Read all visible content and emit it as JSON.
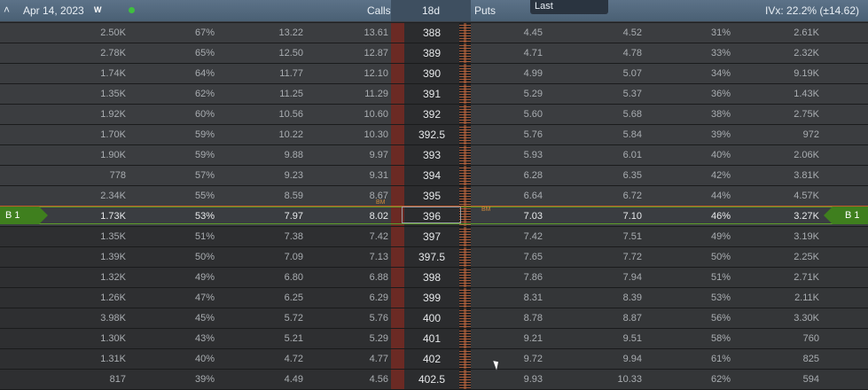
{
  "header": {
    "collapse_icon": "chevron-up-icon",
    "expiration": "Apr 14, 2023",
    "weekly_flag": "W",
    "status_dot_color": "#3fbf3f",
    "calls_label": "Calls",
    "dte_label": "18d",
    "puts_label": "Puts",
    "last_label": "Last",
    "ivx": "IVx: 22.2% (±14.62)"
  },
  "atm": {
    "left_tag": "B 1",
    "right_tag": "B 1",
    "left_marker": "BM",
    "right_marker": "BM"
  },
  "rows": [
    {
      "cvol": "2.50K",
      "cprob": "67%",
      "cbid": "13.22",
      "cask": "13.61",
      "strike": "388",
      "pbid": "4.45",
      "pask": "4.52",
      "pprob": "31%",
      "pvol": "2.61K"
    },
    {
      "cvol": "2.78K",
      "cprob": "65%",
      "cbid": "12.50",
      "cask": "12.87",
      "strike": "389",
      "pbid": "4.71",
      "pask": "4.78",
      "pprob": "33%",
      "pvol": "2.32K"
    },
    {
      "cvol": "1.74K",
      "cprob": "64%",
      "cbid": "11.77",
      "cask": "12.10",
      "strike": "390",
      "pbid": "4.99",
      "pask": "5.07",
      "pprob": "34%",
      "pvol": "9.19K"
    },
    {
      "cvol": "1.35K",
      "cprob": "62%",
      "cbid": "11.25",
      "cask": "11.29",
      "strike": "391",
      "pbid": "5.29",
      "pask": "5.37",
      "pprob": "36%",
      "pvol": "1.43K"
    },
    {
      "cvol": "1.92K",
      "cprob": "60%",
      "cbid": "10.56",
      "cask": "10.60",
      "strike": "392",
      "pbid": "5.60",
      "pask": "5.68",
      "pprob": "38%",
      "pvol": "2.75K"
    },
    {
      "cvol": "1.70K",
      "cprob": "59%",
      "cbid": "10.22",
      "cask": "10.30",
      "strike": "392.5",
      "pbid": "5.76",
      "pask": "5.84",
      "pprob": "39%",
      "pvol": "972"
    },
    {
      "cvol": "1.90K",
      "cprob": "59%",
      "cbid": "9.88",
      "cask": "9.97",
      "strike": "393",
      "pbid": "5.93",
      "pask": "6.01",
      "pprob": "40%",
      "pvol": "2.06K"
    },
    {
      "cvol": "778",
      "cprob": "57%",
      "cbid": "9.23",
      "cask": "9.31",
      "strike": "394",
      "pbid": "6.28",
      "pask": "6.35",
      "pprob": "42%",
      "pvol": "3.81K"
    },
    {
      "cvol": "2.34K",
      "cprob": "55%",
      "cbid": "8.59",
      "cask": "8.67",
      "strike": "395",
      "pbid": "6.64",
      "pask": "6.72",
      "pprob": "44%",
      "pvol": "4.57K"
    },
    {
      "cvol": "1.73K",
      "cprob": "53%",
      "cbid": "7.97",
      "cask": "8.02",
      "strike": "396",
      "pbid": "7.03",
      "pask": "7.10",
      "pprob": "46%",
      "pvol": "3.27K"
    },
    {
      "cvol": "1.35K",
      "cprob": "51%",
      "cbid": "7.38",
      "cask": "7.42",
      "strike": "397",
      "pbid": "7.42",
      "pask": "7.51",
      "pprob": "49%",
      "pvol": "3.19K"
    },
    {
      "cvol": "1.39K",
      "cprob": "50%",
      "cbid": "7.09",
      "cask": "7.13",
      "strike": "397.5",
      "pbid": "7.65",
      "pask": "7.72",
      "pprob": "50%",
      "pvol": "2.25K"
    },
    {
      "cvol": "1.32K",
      "cprob": "49%",
      "cbid": "6.80",
      "cask": "6.88",
      "strike": "398",
      "pbid": "7.86",
      "pask": "7.94",
      "pprob": "51%",
      "pvol": "2.71K"
    },
    {
      "cvol": "1.26K",
      "cprob": "47%",
      "cbid": "6.25",
      "cask": "6.29",
      "strike": "399",
      "pbid": "8.31",
      "pask": "8.39",
      "pprob": "53%",
      "pvol": "2.11K"
    },
    {
      "cvol": "3.98K",
      "cprob": "45%",
      "cbid": "5.72",
      "cask": "5.76",
      "strike": "400",
      "pbid": "8.78",
      "pask": "8.87",
      "pprob": "56%",
      "pvol": "3.30K"
    },
    {
      "cvol": "1.30K",
      "cprob": "43%",
      "cbid": "5.21",
      "cask": "5.29",
      "strike": "401",
      "pbid": "9.21",
      "pask": "9.51",
      "pprob": "58%",
      "pvol": "760"
    },
    {
      "cvol": "1.31K",
      "cprob": "40%",
      "cbid": "4.72",
      "cask": "4.77",
      "strike": "402",
      "pbid": "9.72",
      "pask": "9.94",
      "pprob": "61%",
      "pvol": "825"
    },
    {
      "cvol": "817",
      "cprob": "39%",
      "cbid": "4.49",
      "cask": "4.56",
      "strike": "402.5",
      "pbid": "9.93",
      "pask": "10.33",
      "pprob": "62%",
      "pvol": "594"
    }
  ],
  "atm_strike": "396",
  "colors": {
    "header_bg": "#4f6579",
    "atm_border": "#5e9e2a",
    "tag_bg": "#3f7f1e",
    "strike_bar": "#6b2a24"
  }
}
